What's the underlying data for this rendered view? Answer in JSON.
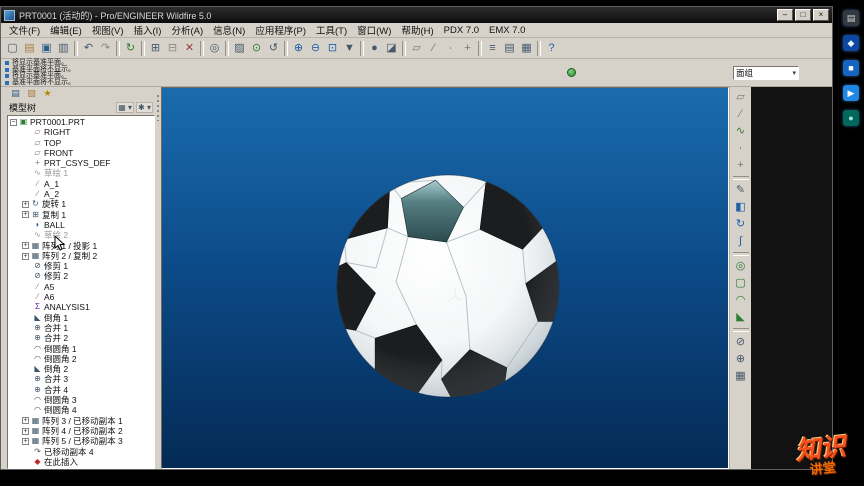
{
  "window": {
    "title": "PRT0001 (活动的) - Pro/ENGINEER Wildfire 5.0",
    "controls": {
      "minimize": "–",
      "maximize": "□",
      "close": "×"
    }
  },
  "menu_bar": {
    "items": [
      "文件(F)",
      "编辑(E)",
      "视图(V)",
      "插入(I)",
      "分析(A)",
      "信息(N)",
      "应用程序(P)",
      "工具(T)",
      "窗口(W)",
      "帮助(H)",
      "PDX 7.0",
      "EMX 7.0"
    ]
  },
  "toolbar": {
    "icons": [
      {
        "name": "new-file-icon",
        "glyph": "▢",
        "color": "#46596a"
      },
      {
        "name": "open-file-icon",
        "glyph": "▤",
        "color": "#a97f3f"
      },
      {
        "name": "save-icon",
        "glyph": "▣",
        "color": "#2f5d8a"
      },
      {
        "name": "print-icon",
        "glyph": "▥",
        "color": "#46596a"
      },
      {
        "sep": true
      },
      {
        "name": "undo-icon",
        "glyph": "↶",
        "color": "#46596a"
      },
      {
        "name": "redo-icon",
        "glyph": "↷",
        "color": "#8a8a8a"
      },
      {
        "sep": true
      },
      {
        "name": "regenerate-icon",
        "glyph": "↻",
        "color": "#2e7d32"
      },
      {
        "sep": true
      },
      {
        "name": "copy-icon",
        "glyph": "⊞",
        "color": "#46596a"
      },
      {
        "name": "paste-icon",
        "glyph": "⊟",
        "color": "#8a8a8a"
      },
      {
        "name": "delete-icon",
        "glyph": "✕",
        "color": "#9c3b3b"
      },
      {
        "sep": true
      },
      {
        "name": "search-icon",
        "glyph": "◎",
        "color": "#46596a"
      },
      {
        "sep": true
      },
      {
        "name": "repaint-icon",
        "glyph": "▨",
        "color": "#46596a"
      },
      {
        "name": "spin-center-icon",
        "glyph": "⊙",
        "color": "#2e7d32"
      },
      {
        "name": "orient-mode-icon",
        "glyph": "↺",
        "color": "#46596a"
      },
      {
        "sep": true
      },
      {
        "name": "zoom-in-icon",
        "glyph": "⊕",
        "color": "#1f5fa8"
      },
      {
        "name": "zoom-out-icon",
        "glyph": "⊖",
        "color": "#1f5fa8"
      },
      {
        "name": "refit-icon",
        "glyph": "⊡",
        "color": "#1f5fa8"
      },
      {
        "name": "named-views-icon",
        "glyph": "▼",
        "color": "#46596a"
      },
      {
        "sep": true
      },
      {
        "name": "display-style-icon",
        "glyph": "●",
        "color": "#46596a"
      },
      {
        "name": "section-view-icon",
        "glyph": "◪",
        "color": "#46596a"
      },
      {
        "sep": true
      },
      {
        "name": "datum-plane-toggle-icon",
        "glyph": "▱",
        "color": "#8d6e63"
      },
      {
        "name": "datum-axis-toggle-icon",
        "glyph": "∕",
        "color": "#8d6e63"
      },
      {
        "name": "datum-point-toggle-icon",
        "glyph": "∙",
        "color": "#8d6e63"
      },
      {
        "name": "csys-toggle-icon",
        "glyph": "+",
        "color": "#8d6e63"
      },
      {
        "sep": true
      },
      {
        "name": "annotation-toggle-icon",
        "glyph": "≡",
        "color": "#46596a"
      },
      {
        "name": "layer-icon",
        "glyph": "▤",
        "color": "#46596a"
      },
      {
        "name": "view-manager-icon",
        "glyph": "▦",
        "color": "#46596a"
      },
      {
        "sep": true
      },
      {
        "name": "context-help-icon",
        "glyph": "?",
        "color": "#1f5fa8"
      }
    ]
  },
  "message_area": {
    "lines": [
      "将显示基准平面。",
      "基准平面将不显示。",
      "将显示基准平面。",
      "基准平面将不显示。"
    ]
  },
  "filter": {
    "value": "面组",
    "arrow": "▾"
  },
  "navigator": {
    "tabs": [
      {
        "name": "model-tree-tab",
        "glyph": "▤",
        "color": "#2f5d8a"
      },
      {
        "name": "folder-browser-tab",
        "glyph": "▧",
        "color": "#a97f3f"
      },
      {
        "name": "favorites-tab",
        "glyph": "★",
        "color": "#b8860b"
      }
    ],
    "header": {
      "title": "模型树",
      "buttons": [
        {
          "name": "tree-show-button",
          "glyph": "▦",
          "arrow": "▾"
        },
        {
          "name": "tree-settings-button",
          "glyph": "✱",
          "arrow": "▾"
        }
      ]
    }
  },
  "model_tree": {
    "items": [
      {
        "label": "PRT0001.PRT",
        "glyph": "▣",
        "color": "#2e7d32",
        "expander": "minus",
        "indent": 0
      },
      {
        "label": "RIGHT",
        "glyph": "▱",
        "color": "#8d6e63",
        "indent": 1
      },
      {
        "label": "TOP",
        "glyph": "▱",
        "color": "#8d6e63",
        "indent": 1
      },
      {
        "label": "FRONT",
        "glyph": "▱",
        "color": "#8d6e63",
        "indent": 1
      },
      {
        "label": "PRT_CSYS_DEF",
        "glyph": "+",
        "color": "#8d6e63",
        "indent": 1
      },
      {
        "label": "草绘 1",
        "glyph": "∿",
        "color": "#979797",
        "dim": true,
        "indent": 1
      },
      {
        "label": "A_1",
        "glyph": "∕",
        "color": "#8d6e63",
        "indent": 1
      },
      {
        "label": "A_2",
        "glyph": "∕",
        "color": "#8d6e63",
        "indent": 1
      },
      {
        "label": "旋转 1",
        "glyph": "↻",
        "color": "#3f5566",
        "expander": "plus",
        "indent": 1
      },
      {
        "label": "复制 1",
        "glyph": "⊞",
        "color": "#3f5566",
        "expander": "plus",
        "indent": 1
      },
      {
        "label": "BALL",
        "glyph": "◗",
        "color": "#1f5fa8",
        "indent": 1
      },
      {
        "label": "草绘 2",
        "glyph": "∿",
        "color": "#979797",
        "dim": true,
        "indent": 1
      },
      {
        "label": "阵列 1 / 投影 1",
        "glyph": "▦",
        "color": "#3f5566",
        "expander": "plus",
        "indent": 1
      },
      {
        "label": "阵列 2 / 复制 2",
        "glyph": "▦",
        "color": "#3f5566",
        "expander": "plus",
        "indent": 1
      },
      {
        "label": "修剪 1",
        "glyph": "⊘",
        "color": "#3f5566",
        "indent": 1
      },
      {
        "label": "修剪 2",
        "glyph": "⊘",
        "color": "#3f5566",
        "indent": 1
      },
      {
        "label": "A5",
        "glyph": "∕",
        "color": "#8d6e63",
        "indent": 1
      },
      {
        "label": "A6",
        "glyph": "∕",
        "color": "#8d6e63",
        "indent": 1
      },
      {
        "label": "ANALYSIS1",
        "glyph": "Σ",
        "color": "#6a1b9a",
        "indent": 1
      },
      {
        "label": "倒角 1",
        "glyph": "◣",
        "color": "#3f5566",
        "indent": 1
      },
      {
        "label": "合并 1",
        "glyph": "⊕",
        "color": "#3f5566",
        "indent": 1
      },
      {
        "label": "合并 2",
        "glyph": "⊕",
        "color": "#3f5566",
        "indent": 1
      },
      {
        "label": "倒圆角 1",
        "glyph": "◠",
        "color": "#3f5566",
        "indent": 1
      },
      {
        "label": "倒圆角 2",
        "glyph": "◠",
        "color": "#3f5566",
        "indent": 1
      },
      {
        "label": "倒角 2",
        "glyph": "◣",
        "color": "#3f5566",
        "indent": 1
      },
      {
        "label": "合并 3",
        "glyph": "⊕",
        "color": "#3f5566",
        "indent": 1
      },
      {
        "label": "合并 4",
        "glyph": "⊕",
        "color": "#3f5566",
        "indent": 1
      },
      {
        "label": "倒圆角 3",
        "glyph": "◠",
        "color": "#3f5566",
        "indent": 1
      },
      {
        "label": "倒圆角 4",
        "glyph": "◠",
        "color": "#3f5566",
        "indent": 1
      },
      {
        "label": "阵列 3 / 已移动副本 1",
        "glyph": "▦",
        "color": "#3f5566",
        "expander": "plus",
        "indent": 1
      },
      {
        "label": "阵列 4 / 已移动副本 2",
        "glyph": "▦",
        "color": "#3f5566",
        "expander": "plus",
        "indent": 1
      },
      {
        "label": "阵列 5 / 已移动副本 3",
        "glyph": "▦",
        "color": "#3f5566",
        "expander": "plus",
        "indent": 1
      },
      {
        "label": "已移动副本 4",
        "glyph": "↷",
        "color": "#3f5566",
        "indent": 1
      },
      {
        "label": "在此插入",
        "glyph": "◆",
        "color": "#c62828",
        "indent": 1
      }
    ]
  },
  "right_toolbar": {
    "icons": [
      {
        "name": "datum-plane-tool-icon",
        "glyph": "▱",
        "color": "#8d6e63"
      },
      {
        "name": "datum-axis-tool-icon",
        "glyph": "∕",
        "color": "#8d6e63"
      },
      {
        "name": "datum-curve-tool-icon",
        "glyph": "∿",
        "color": "#2e7d32"
      },
      {
        "name": "datum-point-tool-icon",
        "glyph": "∙",
        "color": "#2e7d32"
      },
      {
        "name": "csys-tool-icon",
        "glyph": "+",
        "color": "#8d6e63"
      },
      {
        "sep": true
      },
      {
        "name": "sketch-tool-icon",
        "glyph": "✎",
        "color": "#46596a"
      },
      {
        "name": "extrude-tool-icon",
        "glyph": "◧",
        "color": "#1f5fa8"
      },
      {
        "name": "revolve-tool-icon",
        "glyph": "↻",
        "color": "#1f5fa8"
      },
      {
        "name": "sweep-tool-icon",
        "glyph": "∫",
        "color": "#1f5fa8"
      },
      {
        "sep": true
      },
      {
        "name": "hole-tool-icon",
        "glyph": "◎",
        "color": "#2e7d32"
      },
      {
        "name": "shell-tool-icon",
        "glyph": "▢",
        "color": "#2e7d32"
      },
      {
        "name": "round-tool-icon",
        "glyph": "◠",
        "color": "#2e7d32"
      },
      {
        "name": "chamfer-tool-icon",
        "glyph": "◣",
        "color": "#2e7d32"
      },
      {
        "sep": true
      },
      {
        "name": "trim-tool-icon",
        "glyph": "⊘",
        "color": "#46596a"
      },
      {
        "name": "merge-tool-icon",
        "glyph": "⊕",
        "color": "#46596a"
      },
      {
        "name": "pattern-tool-icon",
        "glyph": "▦",
        "color": "#46596a"
      }
    ]
  },
  "viewport": {
    "bg_top": "#1a6cad",
    "bg_bottom": "#042a55",
    "model": "soccer-ball"
  },
  "dock": {
    "icons": [
      {
        "name": "dock-icon-1",
        "glyph": "▤",
        "bg": "#33393e",
        "color": "#cfd8dc"
      },
      {
        "name": "dock-icon-2",
        "glyph": "◆",
        "bg": "#0d47a1",
        "color": "#e3f2fd"
      },
      {
        "name": "dock-icon-3",
        "glyph": "■",
        "bg": "#1565c0",
        "color": "#ffffff"
      },
      {
        "name": "dock-icon-4",
        "glyph": "▶",
        "bg": "#1e88e5",
        "color": "#ffffff"
      },
      {
        "name": "dock-icon-5",
        "glyph": "●",
        "bg": "#00695c",
        "color": "#b2dfdb"
      }
    ]
  },
  "watermark": {
    "line1": "知识",
    "line2": "讲堂"
  }
}
